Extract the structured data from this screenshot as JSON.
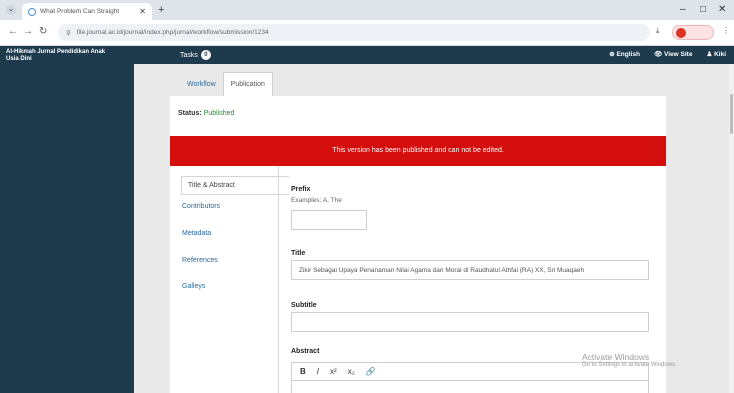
{
  "browser": {
    "tab_title": "What Problem Can Straight",
    "url": "file.journal.ac.id/journal/index.php/jurnal/workflow/submission/1234"
  },
  "app": {
    "site_name": "Al-Hikmah Jurnal Pendidikan Anak Usia Dini",
    "tasks_label": "Tasks",
    "tasks_count": "0",
    "language": "English",
    "view_site": "View Site",
    "user": "Kiki"
  },
  "tabs": [
    "Workflow",
    "Publication"
  ],
  "status": {
    "label": "Status:",
    "value": "Published"
  },
  "banner": "This version has been published and can not be edited.",
  "side_tabs": [
    "Title & Abstract",
    "Contributors",
    "Metadata",
    "References",
    "Galleys"
  ],
  "form": {
    "prefix_label": "Prefix",
    "prefix_hint": "Examples: A, The",
    "prefix_value": "",
    "title_label": "Title",
    "title_value": "Zikir Sebagai Upaya Penanaman Nilai Agama dan Moral di Raudhatul Athfal (RA) XX, Sri Muaqaeh",
    "subtitle_label": "Subtitle",
    "subtitle_value": "",
    "abstract_label": "Abstract"
  },
  "toolbar": {
    "bold": "B",
    "italic": "I",
    "superscript": "x²",
    "subscript": "x₂",
    "link": "🔗"
  },
  "watermark": {
    "title": "Activate Windows",
    "subtitle": "Go to Settings to activate Windows."
  }
}
